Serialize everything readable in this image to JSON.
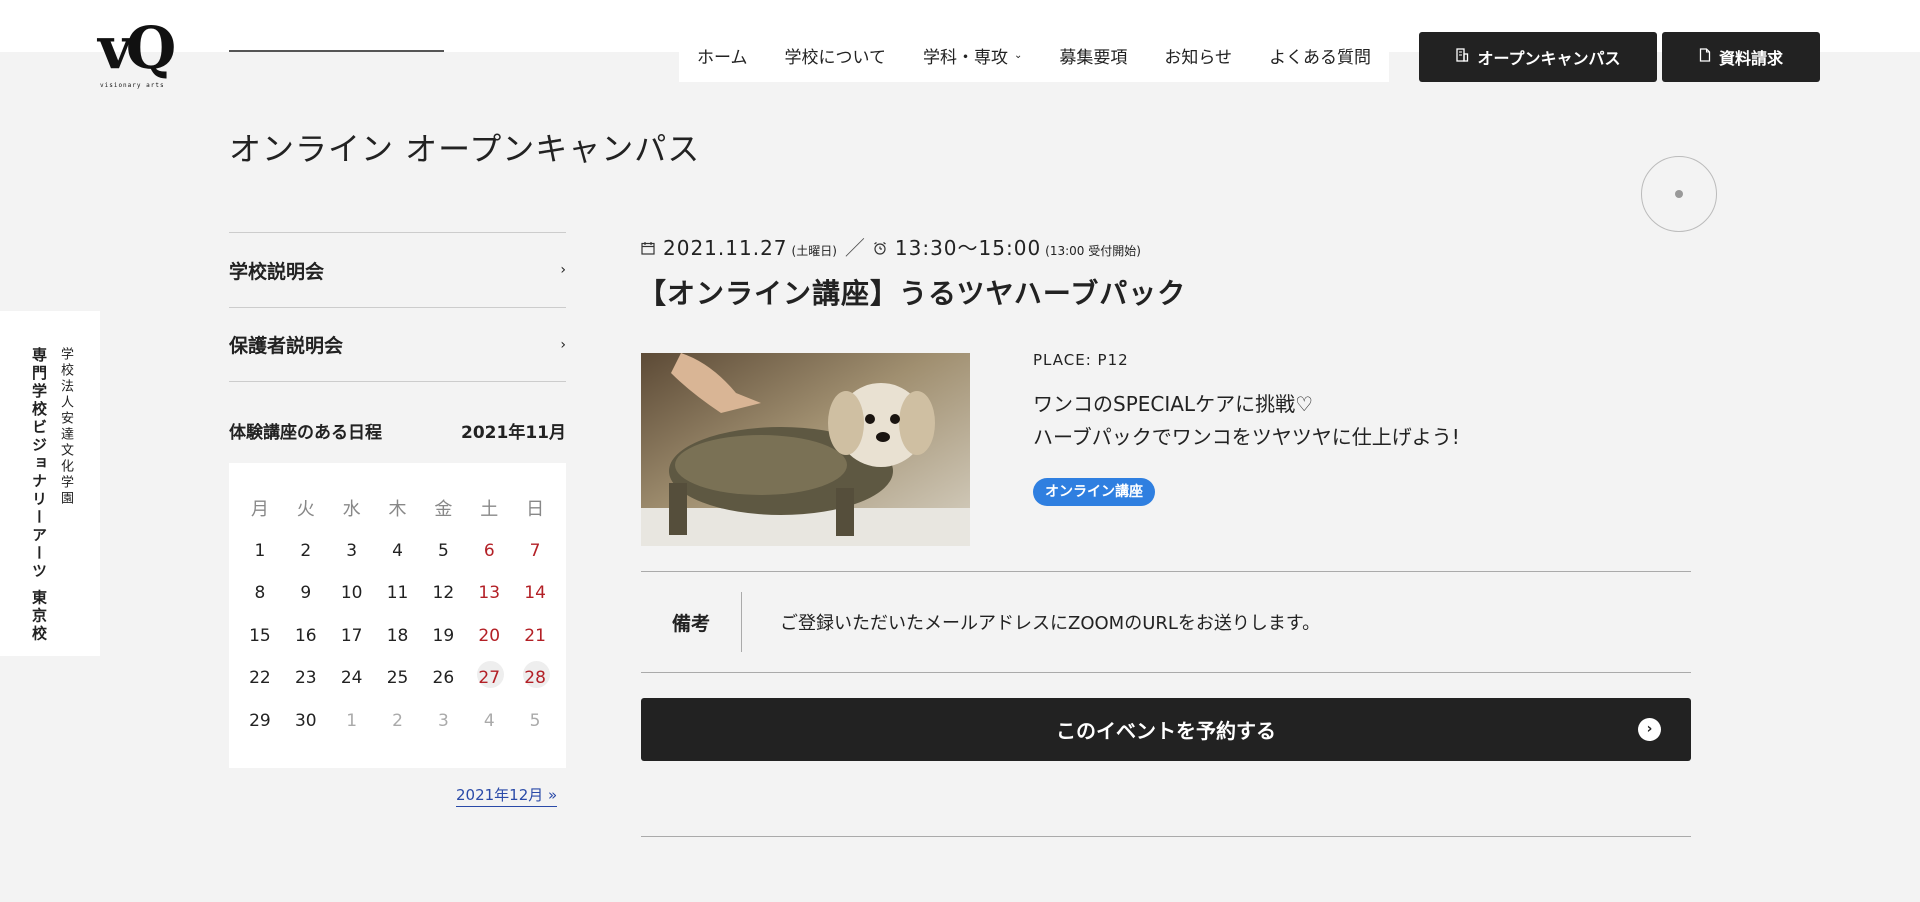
{
  "logo": {
    "mark": "vQ",
    "sub": "visionary arts"
  },
  "nav": {
    "items": [
      {
        "label": "ホーム"
      },
      {
        "label": "学校について"
      },
      {
        "label": "学科・専攻",
        "dropdown": true
      },
      {
        "label": "募集要項"
      },
      {
        "label": "お知らせ"
      },
      {
        "label": "よくある質問"
      }
    ],
    "open_campus_btn": "オープンキャンパス",
    "document_btn": "資料請求"
  },
  "page": {
    "title": "オンライン オープンキャンパス"
  },
  "side_tab": {
    "line1": "学校法人安達文化学園",
    "line2": "専門学校ビジョナリーアーツ 東京校"
  },
  "side_menu": {
    "items": [
      "学校説明会",
      "保護者説明会"
    ]
  },
  "calendar": {
    "heading": "体験講座のある日程",
    "month": "2021年11月",
    "weekdays": [
      "月",
      "火",
      "水",
      "木",
      "金",
      "土",
      "日"
    ],
    "weeks": [
      [
        "1",
        "2",
        "3",
        "4",
        "5",
        "6",
        "7"
      ],
      [
        "8",
        "9",
        "10",
        "11",
        "12",
        "13",
        "14"
      ],
      [
        "15",
        "16",
        "17",
        "18",
        "19",
        "20",
        "21"
      ],
      [
        "22",
        "23",
        "24",
        "25",
        "26",
        "27",
        "28"
      ],
      [
        "29",
        "30",
        "1",
        "2",
        "3",
        "4",
        "5"
      ]
    ],
    "highlighted": [
      "27",
      "28"
    ],
    "next_month": "2021年12月 »"
  },
  "event": {
    "date": "2021.11.27",
    "weekday": "(土曜日)",
    "time": "13:30〜15:00",
    "reception": "(13:00 受付開始)",
    "title": "【オンライン講座】うるツヤハーブパック",
    "place": "PLACE:  P12",
    "desc_line1": "ワンコのSPECIALケアに挑戦♡",
    "desc_line2": "ハーブパックでワンコをツヤツヤに仕上げよう!",
    "tag": "オンライン講座",
    "note_label": "備考",
    "note_text": "ご登録いただいたメールアドレスにZOOMのURLをお送りします。",
    "reserve_btn": "このイベントを予約する"
  },
  "colors": {
    "accent_dark": "#222222",
    "holiday_red": "#b32026",
    "tag_blue": "#2f7fe0",
    "link_blue": "#2a4aa8"
  },
  "icons": [
    "building-icon",
    "document-icon",
    "calendar-icon",
    "alarm-clock-icon",
    "chevron-right-icon",
    "circle-arrow-icon"
  ]
}
